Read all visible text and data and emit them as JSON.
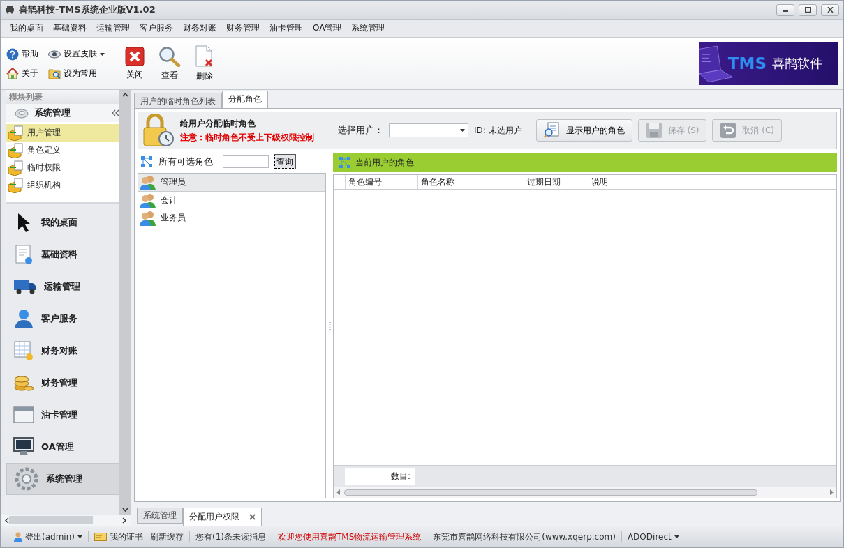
{
  "window": {
    "title": "喜鹊科技-TMS系统企业版V1.02"
  },
  "menu": [
    "我的桌面",
    "基础资料",
    "运输管理",
    "客户服务",
    "财务对账",
    "财务管理",
    "油卡管理",
    "OA管理",
    "系统管理"
  ],
  "toolbar": {
    "small_buttons": [
      {
        "label": "帮助",
        "dropdown": false
      },
      {
        "label": "设置皮肤",
        "dropdown": true
      },
      {
        "label": "关于",
        "dropdown": false
      },
      {
        "label": "设为常用",
        "dropdown": false
      }
    ],
    "large_buttons": [
      "关闭",
      "查看",
      "删除"
    ],
    "banner": {
      "brand": "TMS",
      "name": "喜鹊软件"
    }
  },
  "sidebar": {
    "title": "模块列表",
    "group": "系统管理",
    "items": [
      {
        "label": "用户管理",
        "selected": true
      },
      {
        "label": "角色定义",
        "selected": false
      },
      {
        "label": "临时权限",
        "selected": false
      },
      {
        "label": "组织机构",
        "selected": false
      }
    ],
    "nav": [
      {
        "label": "我的桌面",
        "selected": false
      },
      {
        "label": "基础资料",
        "selected": false
      },
      {
        "label": "运输管理",
        "selected": false
      },
      {
        "label": "客户服务",
        "selected": false
      },
      {
        "label": "财务对账",
        "selected": false
      },
      {
        "label": "财务管理",
        "selected": false
      },
      {
        "label": "油卡管理",
        "selected": false
      },
      {
        "label": "OA管理",
        "selected": false
      },
      {
        "label": "系统管理",
        "selected": true
      }
    ]
  },
  "tabs": [
    {
      "label": "用户的临时角色列表",
      "selected": false
    },
    {
      "label": "分配角色",
      "selected": true
    }
  ],
  "assign": {
    "title": "给用户分配临时角色",
    "warning": "注意：临时角色不受上下级权限控制",
    "user_label": "选择用户：",
    "id_text": "ID: 未选用户",
    "buttons": [
      {
        "label": "显示用户的角色",
        "disabled": false
      },
      {
        "label": "保存 (S)",
        "disabled": true
      },
      {
        "label": "取消 (C)",
        "disabled": true
      }
    ]
  },
  "available": {
    "title": "所有可选角色",
    "search_button": "查询",
    "roles": [
      {
        "label": "管理员",
        "selected": true
      },
      {
        "label": "会计",
        "selected": false
      },
      {
        "label": "业务员",
        "selected": false
      }
    ]
  },
  "current": {
    "title": "当前用户的角色",
    "columns": [
      "角色编号",
      "角色名称",
      "过期日期",
      "说明"
    ],
    "count_label": "数目:"
  },
  "doc_tabs": [
    {
      "label": "系统管理",
      "selected": false,
      "closable": false
    },
    {
      "label": "分配用户权限",
      "selected": true,
      "closable": true
    }
  ],
  "status_bar": [
    {
      "text": "登出(admin)",
      "kind": "user"
    },
    {
      "text": "我的证书",
      "kind": "cert"
    },
    {
      "text": "刷新缓存",
      "kind": "plain"
    },
    {
      "text": "您有(1)条未读消息",
      "kind": "plain"
    },
    {
      "text": "欢迎您使用喜鹊TMS物流运输管理系统",
      "kind": "alert"
    },
    {
      "text": "东莞市喜鹊网络科技有限公司(www.xqerp.com)",
      "kind": "plain"
    },
    {
      "text": "ADODirect",
      "kind": "menu"
    }
  ]
}
